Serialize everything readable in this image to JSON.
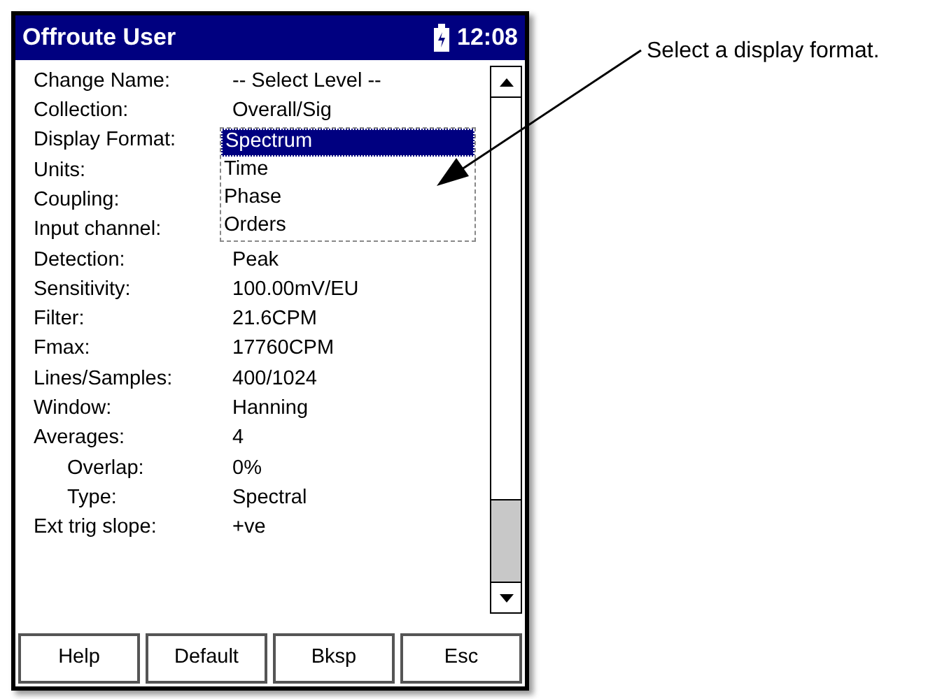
{
  "window": {
    "title": "Offroute User",
    "time": "12:08"
  },
  "fields": [
    {
      "label": "Change Name:",
      "value": "-- Select Level --"
    },
    {
      "label": "Collection:",
      "value": "Overall/Sig"
    },
    {
      "label": "Display Format:"
    },
    {
      "label": "Units:"
    },
    {
      "label": "Coupling:"
    },
    {
      "label": "Input channel:"
    },
    {
      "label": "Detection:",
      "value": "Peak"
    },
    {
      "label": "Sensitivity:",
      "value": "100.00mV/EU"
    },
    {
      "label": "Filter:",
      "value": "21.6CPM"
    },
    {
      "label": "Fmax:",
      "value": "17760CPM"
    },
    {
      "label": "Lines/Samples:",
      "value": "400/1024"
    },
    {
      "label": "Window:",
      "value": "Hanning"
    },
    {
      "label": "Averages:",
      "value": "4",
      "children": [
        {
          "label": "Overlap:",
          "value": "0%"
        },
        {
          "label": "Type:",
          "value": "Spectral"
        }
      ]
    },
    {
      "label": "Ext trig slope:",
      "value": "+ve"
    }
  ],
  "dropdown": {
    "options": [
      {
        "label": "Spectrum",
        "selected": true
      },
      {
        "label": "Time",
        "selected": false
      },
      {
        "label": "Phase",
        "selected": false
      },
      {
        "label": "Orders",
        "selected": false
      }
    ]
  },
  "buttons": [
    "Help",
    "Default",
    "Bksp",
    "Esc"
  ],
  "callout": "Select a display format."
}
